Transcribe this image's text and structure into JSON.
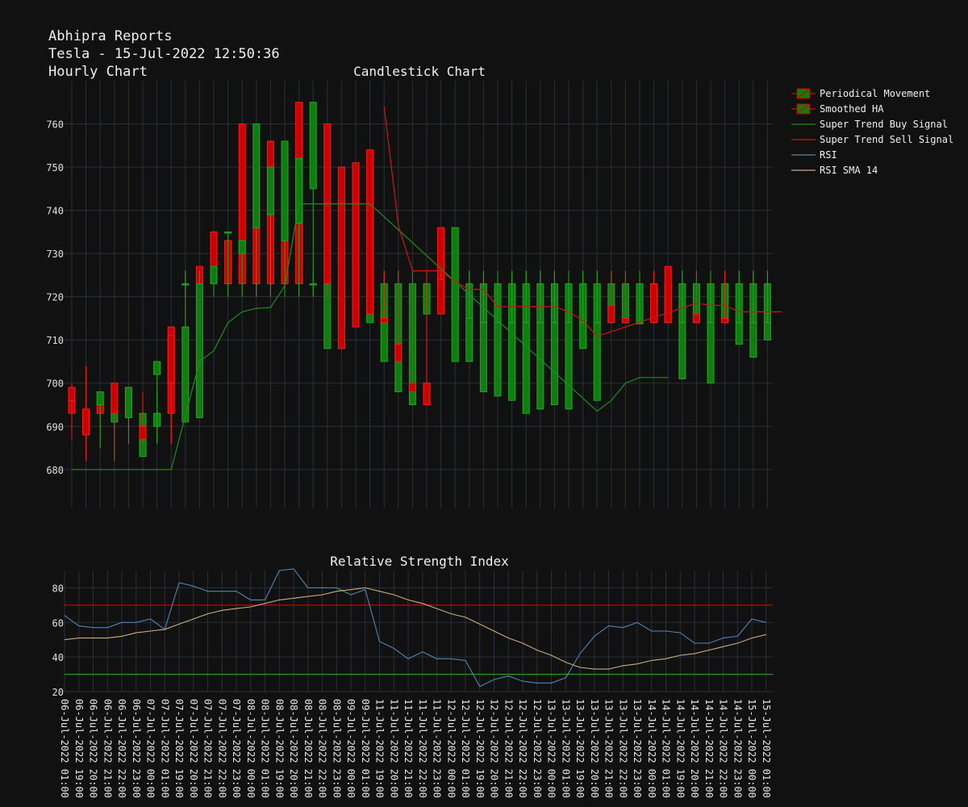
{
  "header": {
    "line1": "Abhipra Reports",
    "line2": "Tesla - 15-Jul-2022 12:50:36",
    "line3": "Hourly Chart"
  },
  "colors": {
    "background": "#111111",
    "grid": "#2a2f3a",
    "up": "#0f7d0f",
    "up_border": "#1faa1f",
    "down": "#cc0000",
    "down_border": "#ff1a1a",
    "buy": "#1b8f1b",
    "sell": "#d11414",
    "rsi": "#4f86b0",
    "rsi_sma": "#c9ad7f",
    "rsi_upper": "#cc0000",
    "rsi_lower": "#2a8f2a"
  },
  "legend": [
    {
      "label": "Periodical Movement",
      "icon": "candle-icon"
    },
    {
      "label": "Smoothed HA",
      "icon": "candle-icon"
    },
    {
      "label": "Super Trend Buy Signal",
      "icon": "green-line-icon"
    },
    {
      "label": "Super Trend Sell Signal",
      "icon": "red-line-icon"
    },
    {
      "label": "RSI",
      "icon": "blue-line-icon"
    },
    {
      "label": "RSI SMA 14",
      "icon": "tan-line-icon"
    }
  ],
  "chart_data": [
    {
      "type": "candlestick",
      "title": "Candlestick Chart",
      "ylim": [
        671,
        770
      ],
      "yticks": [
        680,
        690,
        700,
        710,
        720,
        730,
        740,
        750,
        760
      ],
      "grid": true,
      "legend_position": "right",
      "x": [
        "06-Jul-2022 01:00",
        "06-Jul-2022 19:00",
        "06-Jul-2022 20:00",
        "06-Jul-2022 21:00",
        "06-Jul-2022 22:00",
        "06-Jul-2022 23:00",
        "07-Jul-2022 00:00",
        "07-Jul-2022 01:00",
        "07-Jul-2022 19:00",
        "07-Jul-2022 20:00",
        "07-Jul-2022 21:00",
        "07-Jul-2022 22:00",
        "07-Jul-2022 23:00",
        "08-Jul-2022 00:00",
        "08-Jul-2022 01:00",
        "08-Jul-2022 19:00",
        "08-Jul-2022 20:00",
        "08-Jul-2022 21:00",
        "08-Jul-2022 22:00",
        "08-Jul-2022 23:00",
        "09-Jul-2022 00:00",
        "09-Jul-2022 01:00",
        "11-Jul-2022 19:00",
        "11-Jul-2022 20:00",
        "11-Jul-2022 21:00",
        "11-Jul-2022 22:00",
        "11-Jul-2022 23:00",
        "12-Jul-2022 00:00",
        "12-Jul-2022 01:00",
        "12-Jul-2022 19:00",
        "12-Jul-2022 20:00",
        "12-Jul-2022 21:00",
        "12-Jul-2022 22:00",
        "12-Jul-2022 23:00",
        "13-Jul-2022 00:00",
        "13-Jul-2022 01:00",
        "13-Jul-2022 19:00",
        "13-Jul-2022 20:00",
        "13-Jul-2022 21:00",
        "13-Jul-2022 22:00",
        "13-Jul-2022 23:00",
        "14-Jul-2022 00:00",
        "14-Jul-2022 01:00",
        "14-Jul-2022 19:00",
        "14-Jul-2022 20:00",
        "14-Jul-2022 21:00",
        "14-Jul-2022 22:00",
        "14-Jul-2022 23:00",
        "15-Jul-2022 00:00",
        "15-Jul-2022 01:00"
      ],
      "series": [
        {
          "name": "Periodical Movement",
          "open": [
            696,
            689,
            696,
            691,
            699,
            683,
            690,
            713,
            723,
            727,
            735,
            733,
            760,
            750,
            756,
            752,
            765,
            723,
            708,
            713,
            716,
            714,
            705,
            698,
            695,
            716,
            736,
            715,
            714,
            714,
            714,
            714,
            714,
            714,
            714,
            714,
            714,
            714,
            714,
            714,
            714,
            714,
            714,
            714,
            714,
            714,
            714,
            714,
            714,
            714
          ],
          "close": [
            693,
            693,
            693,
            693,
            693,
            693,
            693,
            693,
            723,
            723,
            723,
            723,
            723,
            723,
            723,
            723,
            723,
            723,
            723,
            723,
            723,
            723,
            723,
            723,
            723,
            723,
            723,
            723,
            723,
            723,
            723,
            723,
            723,
            723,
            723,
            723,
            723,
            723,
            723,
            723,
            723,
            723,
            723,
            723,
            723,
            723,
            723,
            723,
            723,
            723
          ],
          "high": [
            700,
            704,
            698,
            698,
            698,
            698,
            698,
            698,
            726,
            726,
            726,
            726,
            726,
            726,
            726,
            726,
            726,
            726,
            726,
            726,
            726,
            726,
            726,
            726,
            726,
            726,
            726,
            726,
            726,
            726,
            726,
            726,
            726,
            726,
            726,
            726,
            726,
            726,
            726,
            726,
            726,
            726,
            726,
            726,
            726,
            726,
            726,
            726,
            726,
            726
          ],
          "low": [
            687,
            682,
            685,
            682,
            686,
            686,
            686,
            686,
            720,
            720,
            720,
            720,
            720,
            720,
            720,
            720,
            720,
            720,
            720,
            720,
            720,
            720,
            720,
            720,
            720,
            720,
            720,
            720,
            720,
            720,
            720,
            720,
            720,
            720,
            720,
            720,
            720,
            720,
            720,
            720,
            720,
            720,
            720,
            720,
            720,
            720,
            720,
            720,
            720,
            720
          ]
        },
        {
          "name": "Smoothed HA",
          "open": [
            699,
            694,
            695,
            700,
            692,
            690,
            702,
            711,
            691,
            692,
            723,
            735,
            730,
            736,
            739,
            733,
            737,
            745,
            760,
            750,
            751,
            754,
            715,
            709,
            700,
            700,
            724,
            705,
            705,
            698,
            697,
            696,
            693,
            694,
            695,
            694,
            708,
            696,
            718,
            715,
            714,
            723,
            727,
            701,
            716,
            700,
            715,
            709,
            706,
            710
          ],
          "close": [
            696,
            688,
            698,
            693,
            699,
            687,
            705,
            700,
            713,
            723,
            727,
            735,
            733,
            760,
            750,
            756,
            752,
            765,
            723,
            708,
            713,
            716,
            714,
            705,
            698,
            695,
            716,
            736,
            715,
            714,
            714,
            714,
            714,
            714,
            714,
            714,
            714,
            714,
            714,
            714,
            714,
            714,
            714,
            714,
            714,
            714,
            714,
            714,
            714,
            714
          ],
          "high": [
            700,
            704,
            698,
            698,
            698,
            698,
            698,
            698,
            726,
            726,
            726,
            726,
            726,
            726,
            726,
            726,
            726,
            726,
            726,
            726,
            726,
            726,
            726,
            726,
            726,
            726,
            726,
            726,
            726,
            726,
            726,
            726,
            726,
            726,
            726,
            726,
            726,
            726,
            726,
            726,
            726,
            726,
            726,
            726,
            726,
            726,
            726,
            726,
            726,
            726
          ],
          "low": [
            687,
            682,
            685,
            682,
            686,
            686,
            686,
            686,
            720,
            720,
            720,
            720,
            720,
            720,
            720,
            720,
            720,
            720,
            720,
            720,
            720,
            720,
            720,
            720,
            720,
            720,
            720,
            720,
            720,
            720,
            720,
            720,
            720,
            720,
            720,
            720,
            720,
            720,
            720,
            720,
            720,
            720,
            720,
            720,
            720,
            720,
            720,
            720,
            720,
            720
          ]
        }
      ],
      "supertrend_buy": [
        [
          0,
          680
        ],
        [
          7,
          680
        ],
        [
          9,
          705
        ],
        [
          10,
          707.5
        ],
        [
          11,
          714
        ],
        [
          12,
          716.5
        ],
        [
          13,
          717.3
        ],
        [
          14,
          717.5
        ],
        [
          15,
          722.5
        ],
        [
          16,
          741.5
        ],
        [
          21,
          741.5
        ],
        [
          37,
          693.5
        ],
        [
          38,
          696
        ],
        [
          39,
          700
        ],
        [
          40,
          701.3
        ],
        [
          42,
          701.3
        ]
      ],
      "supertrend_sell": [
        [
          22,
          764
        ],
        [
          23,
          736.5
        ],
        [
          24,
          726
        ],
        [
          26,
          726
        ],
        [
          27,
          723.5
        ],
        [
          28,
          721.7
        ],
        [
          29,
          721.7
        ],
        [
          30,
          717.7
        ],
        [
          34,
          717.7
        ],
        [
          35,
          716.5
        ],
        [
          36,
          714.5
        ],
        [
          37,
          710.8
        ],
        [
          44,
          718.5
        ],
        [
          45,
          718
        ],
        [
          46,
          718
        ],
        [
          47,
          716.5
        ],
        [
          50,
          716.5
        ]
      ]
    },
    {
      "type": "line",
      "title": "Relative Strength Index",
      "ylim": [
        20,
        90
      ],
      "yticks": [
        20,
        40,
        60,
        80
      ],
      "grid": true,
      "series": [
        {
          "name": "RSI",
          "values": [
            64,
            58,
            57,
            57,
            60,
            60,
            62,
            56,
            83,
            81,
            78,
            78,
            78,
            73,
            73,
            90,
            91,
            80,
            80,
            80,
            76,
            79,
            49,
            45,
            39,
            43,
            39,
            39,
            38,
            23,
            27,
            29,
            26,
            25,
            25,
            28,
            42,
            52,
            58,
            57,
            60,
            55,
            55,
            54,
            48,
            48,
            51,
            52,
            62,
            60
          ]
        },
        {
          "name": "RSI SMA 14",
          "values": [
            50,
            51,
            51,
            51,
            52,
            54,
            55,
            56,
            59,
            62,
            65,
            67,
            68,
            69,
            71,
            73,
            74,
            75,
            76,
            78,
            79,
            80,
            78,
            76,
            73,
            71,
            68,
            65,
            63,
            59,
            55,
            51,
            48,
            44,
            41,
            37,
            34,
            33,
            33,
            35,
            36,
            38,
            39,
            41,
            42,
            44,
            46,
            48,
            51,
            53
          ]
        }
      ],
      "hlines": [
        70,
        30
      ]
    }
  ]
}
